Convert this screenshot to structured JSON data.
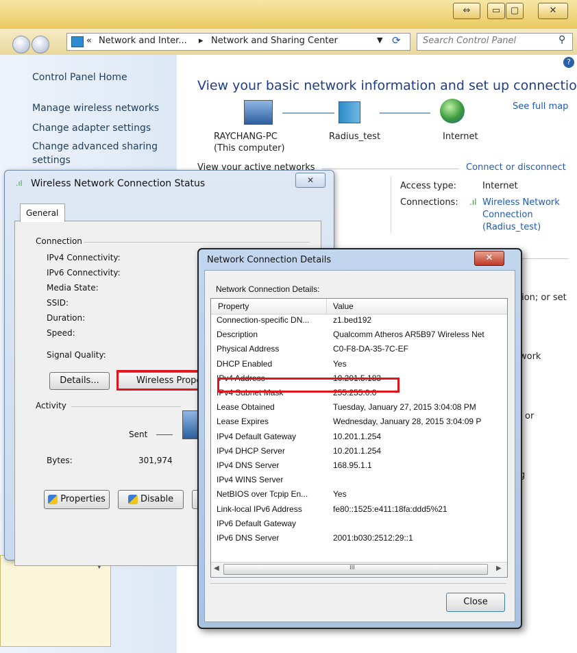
{
  "window": {
    "caption_buttons": {
      "swap": "⇔",
      "minimize": "▭",
      "maximize": "▢",
      "close": "✕"
    },
    "breadcrumb": {
      "prefix": "«",
      "item1": "Network and Inter...",
      "sep": "▸",
      "item2": "Network and Sharing Center"
    },
    "search_placeholder": "Search Control Panel"
  },
  "sidebar": {
    "items": [
      "Control Panel Home",
      "Manage wireless networks",
      "Change adapter settings",
      "Change advanced sharing",
      "settings"
    ]
  },
  "main": {
    "title": "View your basic network information and set up connections",
    "see_full_map": "See full map",
    "nodes": [
      {
        "name": "RAYCHANG-PC",
        "sub": "(This computer)"
      },
      {
        "name": "Radius_test",
        "sub": ""
      },
      {
        "name": "Internet",
        "sub": ""
      }
    ],
    "active_networks_label": "View your active networks",
    "connect_or_disconnect": "Connect or disconnect",
    "access_type_label": "Access type:",
    "access_type_value": "Internet",
    "connections_label": "Connections:",
    "connection_link": [
      "Wireless Network",
      "Connection",
      "(Radius_test)"
    ],
    "partial_texts": [
      "tion; or set",
      "work",
      "or",
      "g"
    ]
  },
  "status_dialog": {
    "title": "Wireless Network Connection Status",
    "close": "✕",
    "tab": "General",
    "connection_header": "Connection",
    "fields": [
      "IPv4 Connectivity:",
      "IPv6 Connectivity:",
      "Media State:",
      "SSID:",
      "Duration:",
      "Speed:"
    ],
    "signal_quality": "Signal Quality:",
    "details_button": "Details...",
    "wireless_button": "Wireless Proper",
    "activity_header": "Activity",
    "sent_label": "Sent",
    "bytes_label": "Bytes:",
    "bytes_value": "301,974",
    "properties_button": "Properties",
    "disable_button": "Disable"
  },
  "details_dialog": {
    "title": "Network Connection Details",
    "close": "✕",
    "header_label": "Network Connection Details:",
    "columns": [
      "Property",
      "Value"
    ],
    "rows": [
      [
        "Connection-specific DN...",
        "z1.bed192"
      ],
      [
        "Description",
        "Qualcomm Atheros AR5B97 Wireless Net"
      ],
      [
        "Physical Address",
        "C0-F8-DA-35-7C-EF"
      ],
      [
        "DHCP Enabled",
        "Yes"
      ],
      [
        "IPv4 Address",
        "10.201.5.183"
      ],
      [
        "IPv4 Subnet Mask",
        "255.255.0.0"
      ],
      [
        "Lease Obtained",
        "Tuesday, January 27, 2015 3:04:08 PM"
      ],
      [
        "Lease Expires",
        "Wednesday, January 28, 2015 3:04:09 P"
      ],
      [
        "IPv4 Default Gateway",
        "10.201.1.254"
      ],
      [
        "IPv4 DHCP Server",
        "10.201.1.254"
      ],
      [
        "IPv4 DNS Server",
        "168.95.1.1"
      ],
      [
        "IPv4 WINS Server",
        ""
      ],
      [
        "NetBIOS over Tcpip En...",
        "Yes"
      ],
      [
        "Link-local IPv6 Address",
        "fe80::1525:e411:18fa:ddd5%21"
      ],
      [
        "IPv6 Default Gateway",
        ""
      ],
      [
        "IPv6 DNS Server",
        "2001:b030:2512:29::1"
      ]
    ],
    "scroll_mark": "III",
    "close_button": "Close"
  },
  "colors": {
    "highlight": "#e0141d",
    "link": "#1e5bb8",
    "titlebar": "#e9c95e"
  }
}
